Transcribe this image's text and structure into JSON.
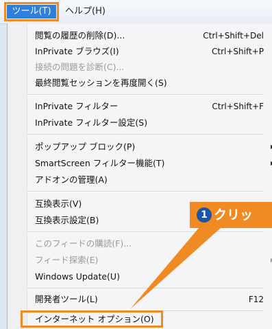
{
  "menubar": {
    "tools_label": "ツール(T)",
    "help_label": "ヘルプ(H)"
  },
  "menu": {
    "items": [
      {
        "label": "閲覧の履歴の削除(D)...",
        "shortcut": "Ctrl+Shift+Del",
        "enabled": true
      },
      {
        "label": "InPrivate ブラウズ(I)",
        "shortcut": "Ctrl+Shift+P",
        "enabled": true
      },
      {
        "label": "接続の問題を診断(C)...",
        "shortcut": "",
        "enabled": false
      },
      {
        "label": "最終閲覧セッションを再度開く(S)",
        "shortcut": "",
        "enabled": true
      },
      {
        "label": "InPrivate フィルター",
        "shortcut": "Ctrl+Shift+F",
        "enabled": true
      },
      {
        "label": "InPrivate フィルター設定(S)",
        "shortcut": "",
        "enabled": true
      },
      {
        "label": "ポップアップ ブロック(P)",
        "shortcut": "",
        "enabled": true,
        "submenu": true
      },
      {
        "label": "SmartScreen フィルター機能(T)",
        "shortcut": "",
        "enabled": true,
        "submenu": true
      },
      {
        "label": "アドオンの管理(A)",
        "shortcut": "",
        "enabled": true
      },
      {
        "label": "互換表示(V)",
        "shortcut": "",
        "enabled": true
      },
      {
        "label": "互換表示設定(B)",
        "shortcut": "",
        "enabled": true
      },
      {
        "label": "このフィードの購読(F)...",
        "shortcut": "",
        "enabled": false
      },
      {
        "label": "フィード探索(E)",
        "shortcut": "",
        "enabled": false,
        "submenu": true
      },
      {
        "label": "Windows Update(U)",
        "shortcut": "",
        "enabled": true
      },
      {
        "label": "開発者ツール(L)",
        "shortcut": "F12",
        "enabled": true
      },
      {
        "label": "インターネット オプション(O)",
        "shortcut": "",
        "enabled": true
      }
    ]
  },
  "callout": {
    "number": "1",
    "text": "クリッ"
  },
  "colors": {
    "accent": "#f08a22",
    "selection": "#2f7fdc",
    "badge": "#1a55a8"
  }
}
